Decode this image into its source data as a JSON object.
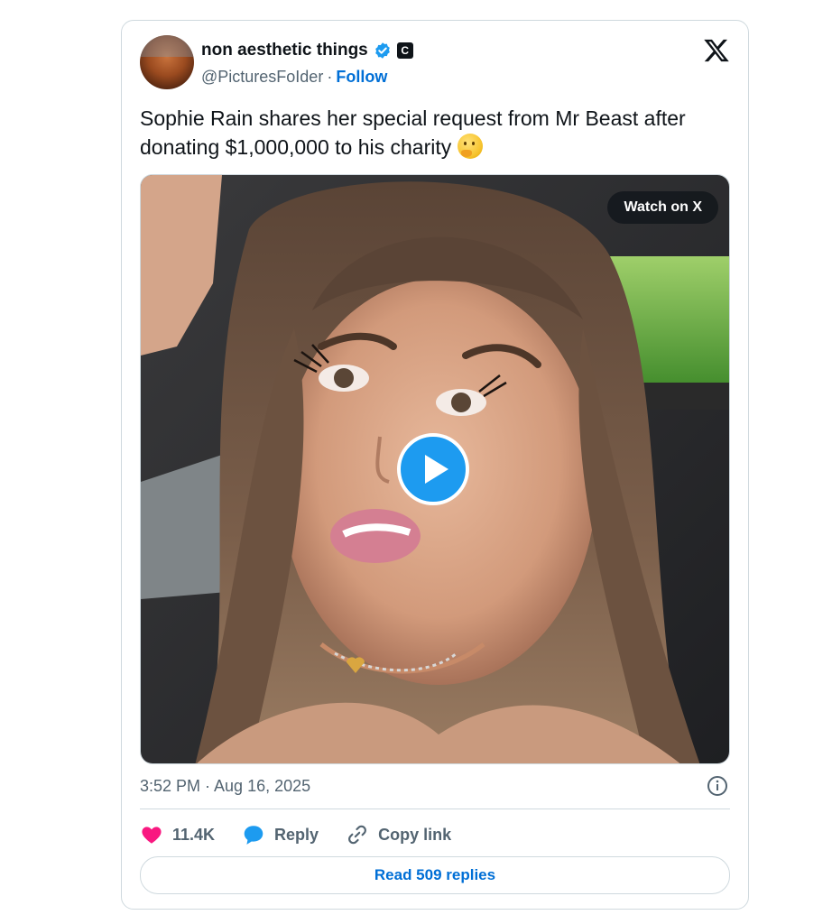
{
  "author": {
    "display_name": "non aesthetic things",
    "handle": "@PicturesFoIder",
    "separator": "·",
    "follow_label": "Follow",
    "badge_letter": "C"
  },
  "tweet": {
    "text": "Sophie Rain shares her special request from Mr Beast after donating $1,000,000 to his charity",
    "emoji": "thinking-face"
  },
  "media": {
    "watch_label": "Watch on X"
  },
  "meta": {
    "timestamp": "3:52 PM · Aug 16, 2025"
  },
  "actions": {
    "like_count": "11.4K",
    "reply_label": "Reply",
    "copy_label": "Copy link"
  },
  "footer": {
    "read_replies_label": "Read 509 replies"
  },
  "colors": {
    "link": "#006fd6",
    "like": "#f91880",
    "reply": "#1d9bf0",
    "play": "#1d9bf0"
  }
}
